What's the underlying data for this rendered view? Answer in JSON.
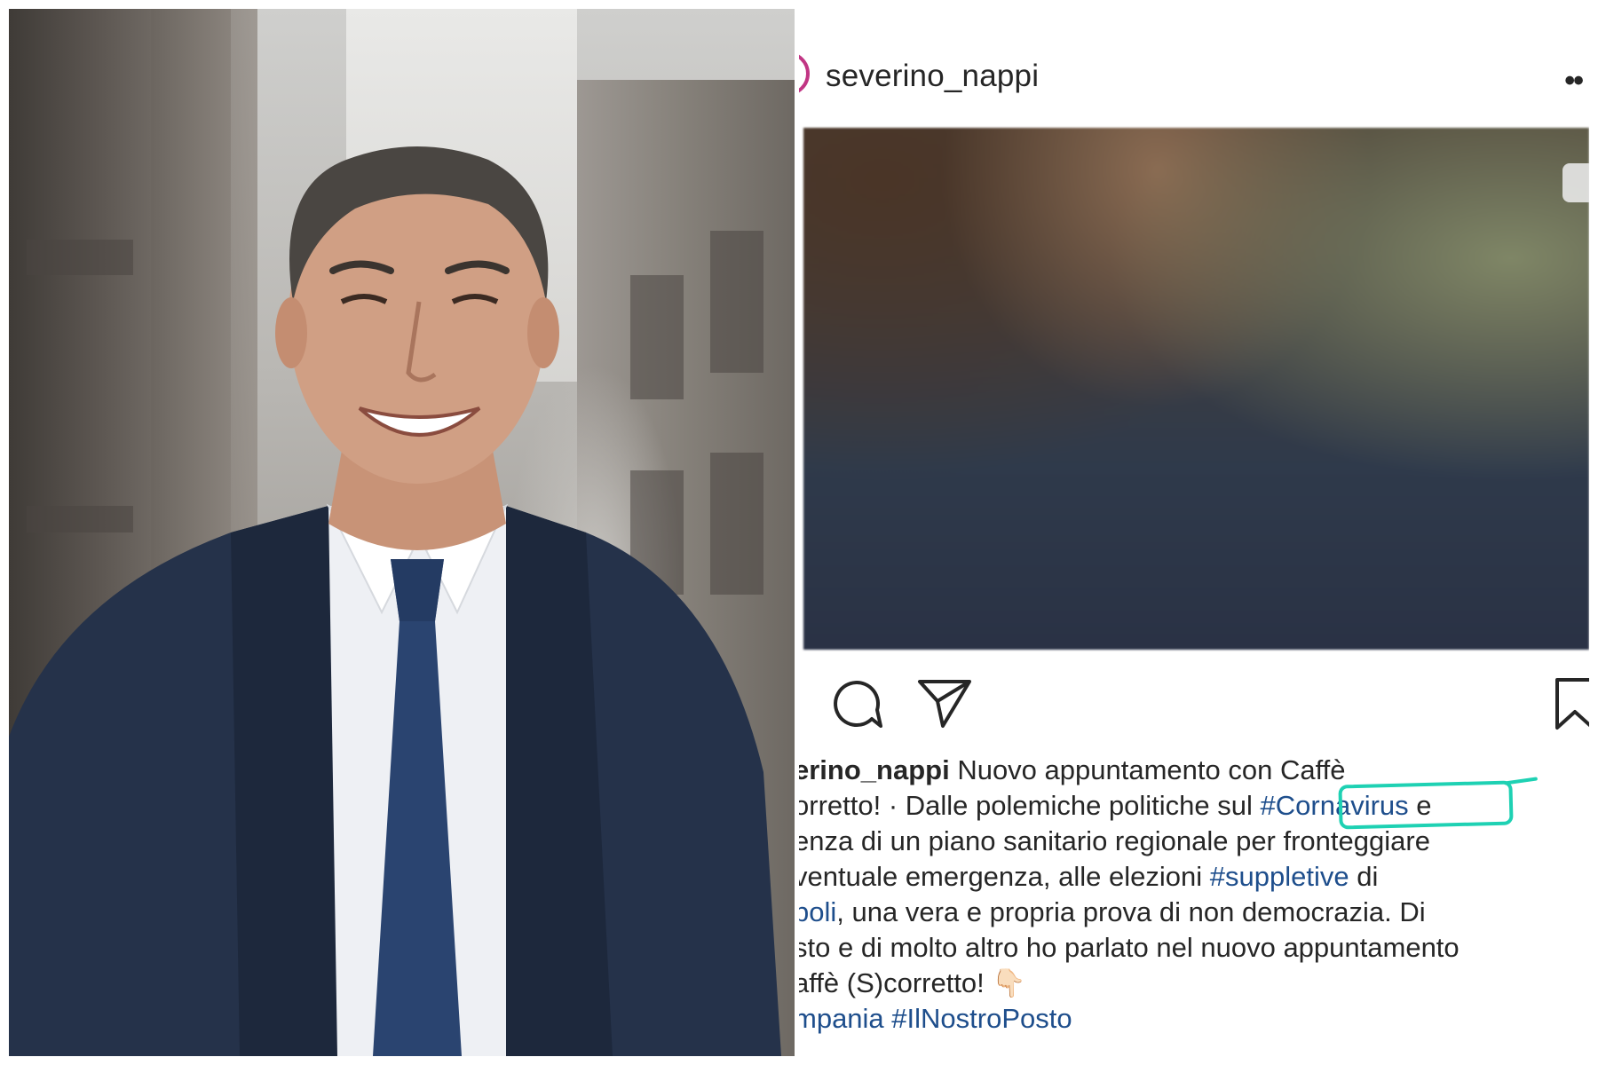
{
  "post": {
    "username": "severino_nappi",
    "more_icon": "more-horizontal-icon",
    "icons": [
      "comment-icon",
      "share-icon",
      "bookmark-icon"
    ],
    "caption": {
      "line1_user": "erino_nappi",
      "line1_text": " Nuovo appuntamento con Caffè",
      "line2_text": "orretto! · Dalle polemiche politiche sul ",
      "line2_tag": "#Cornavirus",
      "line2_end": " e",
      "line3_text": "enza di un piano sanitario regionale per fronteggiare",
      "line4_text": "ventuale emergenza, alle elezioni ",
      "line4_tag": "#suppletive",
      "line4_end": " di",
      "line5_tag": "poli",
      "line5_text": ", una vera e propria prova di non democrazia. Di",
      "line6_text": "sto e di molto altro ho parlato nel nuovo appuntamento",
      "line7_text": "affè (S)corretto! ",
      "line7_emoji": "👇🏻",
      "line8_tags": "mpania #IlNostroPosto"
    },
    "annotation_color": "#1ed1b3",
    "hashtag_color": "#1e4e8c"
  }
}
